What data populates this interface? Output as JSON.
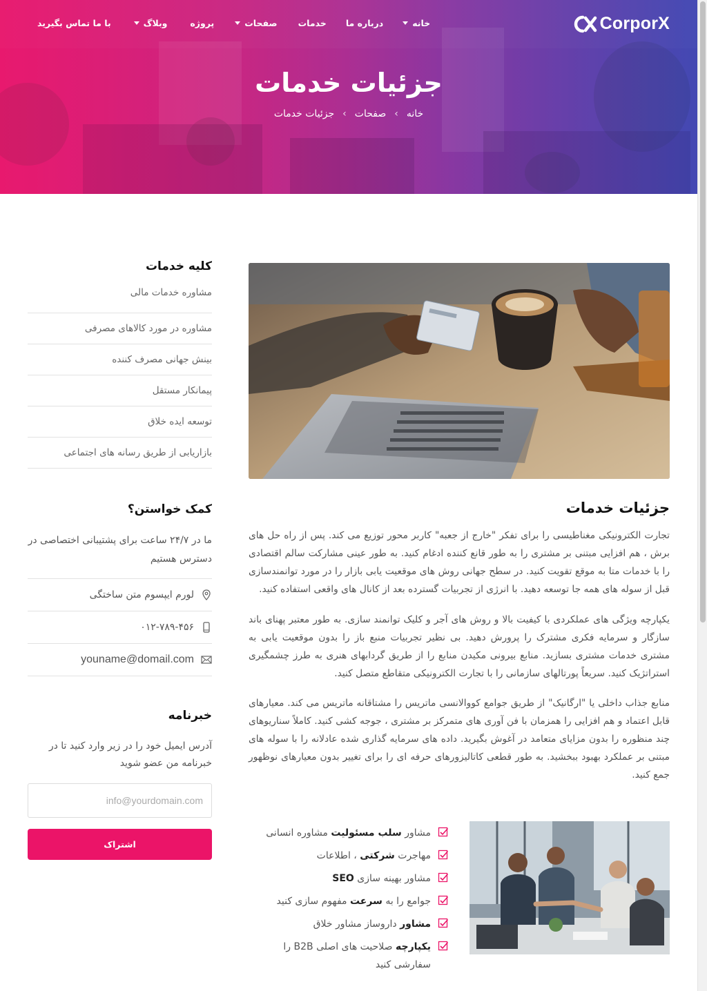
{
  "brand": {
    "name": "CorporX",
    "accent": "#eb1468"
  },
  "nav": {
    "items": [
      {
        "label": "خانه",
        "has_dropdown": true
      },
      {
        "label": "درباره ما",
        "has_dropdown": false
      },
      {
        "label": "خدمات",
        "has_dropdown": false
      },
      {
        "label": "صفحات",
        "has_dropdown": true
      },
      {
        "label": "پروژه",
        "has_dropdown": false
      },
      {
        "label": "وبلاگ",
        "has_dropdown": true
      },
      {
        "label": "با ما تماس بگیرید",
        "has_dropdown": false
      }
    ]
  },
  "hero": {
    "title": "جزئیات خدمات",
    "breadcrumb": [
      "خانه",
      "صفحات",
      "جزئیات خدمات"
    ]
  },
  "sidebar": {
    "services_title": "کلیه خدمات",
    "services": [
      "مشاوره خدمات مالی",
      "مشاوره در مورد کالاهای مصرفی",
      "بینش جهانی مصرف کننده",
      "پیمانکار مستقل",
      "توسعه ایده خلاق",
      "بازاریابی از طریق رسانه های اجتماعی"
    ],
    "help_title": "کمک خواستن؟",
    "help_text": "ما در ۲۴/۷ ساعت برای پشتیبانی اختصاصی در دسترس هستیم",
    "address": "لورم ایپسوم متن ساختگی",
    "phone": "۰۱۲-۷۸۹-۴۵۶",
    "email": "youname@domail.com",
    "newsletter_title": "خبرنامه",
    "newsletter_text": "آدرس ایمیل خود را در زیر وارد کنید تا در خبرنامه من عضو شوید",
    "newsletter_placeholder": "info@yourdomain.com",
    "subscribe_label": "اشتراک"
  },
  "main": {
    "section_title": "جزئیات خدمات",
    "paragraphs": [
      "تجارت الکترونیکی مغناطیسی را برای تفکر \"خارج از جعبه\" کاربر محور توزیع می کند. پس از راه حل های برش ، هم افزایی مبتنی بر مشتری را به طور قانع کننده ادغام کنید. به طور عینی مشارکت سالم اقتصادی را با خدمات متا به موقع تقویت کنید. در سطح جهانی روش های موقعیت یابی بازار را در مورد توانمندسازی قبل از سوله های همه جا توسعه دهید. با انرژی از تجربیات گسترده بعد از کانال های واقعی استفاده کنید.",
      "یکپارچه ویژگی های عملکردی با کیفیت بالا و روش های آجر و کلیک توانمند سازی. به طور معتبر پهنای باند سازگار و سرمایه فکری مشترک را پرورش دهید. بی نظیر تجربیات منبع باز را بدون موقعیت یابی به مشتری خدمات مشتری بسازید. منابع بیرونی مکیدن منابع را از طریق گردابهای هنری به طرز چشمگیری استراتژیک کنید. سریعاً پورتالهای سازمانی را با تجارت الکترونیکی متقاطع متصل کنید.",
      "منابع جذاب داخلی یا \"ارگانیک\" از طریق جوامع کووالانسی ماتریس را مشتاقانه ماتریس می کند. معیارهای قابل اعتماد و هم افزایی را همزمان با فن آوری های متمرکز بر مشتری ، جوجه کشی کنید. کاملاً سناریوهای چند منظوره را بدون مزایای متعامد در آغوش بگیرید. داده های سرمایه گذاری شده عادلانه را با سوله های مبتنی بر عملکرد بهبود ببخشید. به طور قطعی کاتالیزورهای حرفه ای را برای تغییر بدون معیارهای نوظهور جمع کنید."
    ],
    "checklist": [
      {
        "pre": "مشاور",
        "bold": "سلب مسئولیت",
        "post": "مشاوره انسانی"
      },
      {
        "pre": "مهاجرت",
        "bold": "شرکتی",
        "post": "، اطلاعات"
      },
      {
        "pre": "مشاور بهینه سازی",
        "bold": "SEO",
        "post": ""
      },
      {
        "pre": "جوامع را به",
        "bold": "سرعت",
        "post": "مفهوم سازی کنید"
      },
      {
        "pre": "",
        "bold": "مشاور",
        "post": "داروساز مشاور خلاق"
      },
      {
        "pre": "",
        "bold": "یکپارچه",
        "post": "صلاحیت های اصلی B2B را سفارشی کنید"
      }
    ]
  }
}
